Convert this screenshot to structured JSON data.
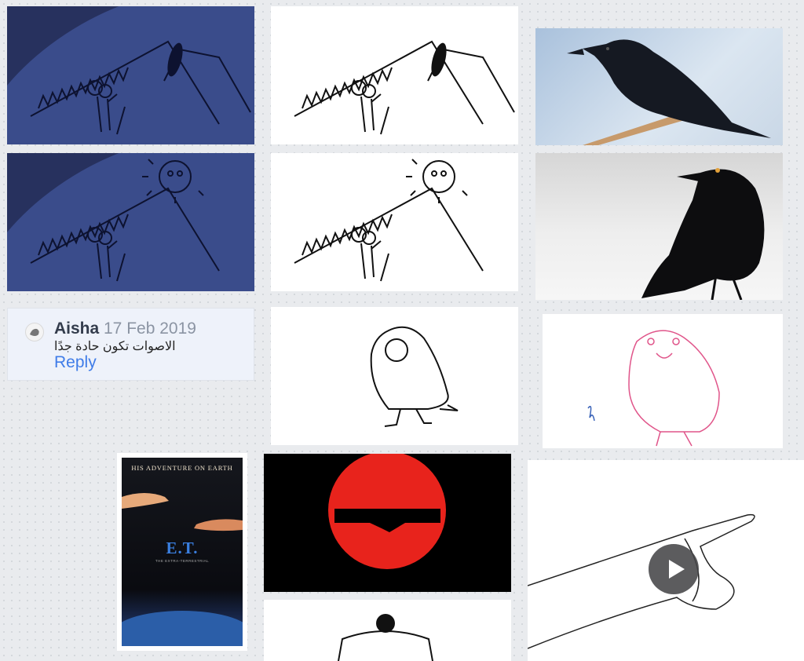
{
  "comment": {
    "author": "Aisha",
    "date": "17 Feb 2019",
    "text": "الاصوات تكون حادة جدًا",
    "reply_label": "Reply"
  },
  "poster": {
    "tagline": "HIS ADVENTURE ON EARTH",
    "title": "E.T.",
    "subtitle": "THE EXTRA-TERRESTRIAL"
  },
  "video": {
    "play_icon": "play-icon"
  },
  "colors": {
    "canvas": "#e9ebee",
    "navy_sketch": "#27315e",
    "navy_fill": "#3a4c8b",
    "reply_link": "#3f7ce8",
    "sun_red": "#e8231c",
    "pink_sketch": "#e0558a"
  }
}
